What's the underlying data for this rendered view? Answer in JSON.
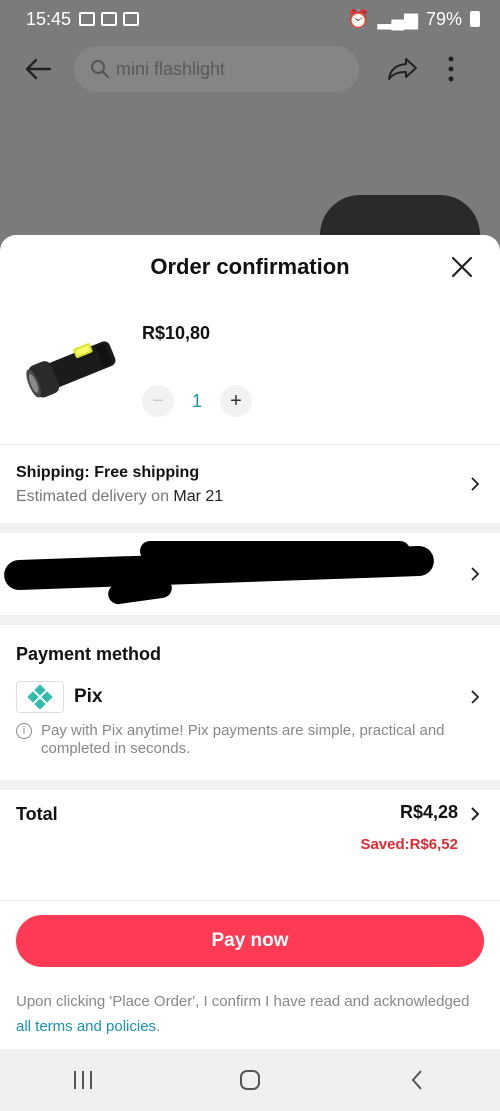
{
  "status_bar": {
    "time": "15:45",
    "battery": "79%"
  },
  "top_nav": {
    "search_placeholder": "mini flashlight"
  },
  "sheet": {
    "title": "Order confirmation",
    "product": {
      "price": "R$10,80",
      "quantity": "1",
      "minus": "−",
      "plus": "+"
    },
    "shipping": {
      "title": "Shipping: Free shipping",
      "delivery_prefix": "Estimated delivery on ",
      "delivery_date": "Mar 21"
    },
    "payment": {
      "title": "Payment method",
      "method": "Pix",
      "note": "Pay with Pix anytime! Pix payments are simple, practical and completed in seconds."
    },
    "total": {
      "label": "Total",
      "value": "R$4,28",
      "saved": "Saved:R$6,52"
    },
    "footer": {
      "pay_button": "Pay now",
      "terms_prefix": "Upon clicking 'Place Order', I confirm I have read and acknowledged ",
      "terms_link": "all terms and policies",
      "terms_suffix": "."
    }
  },
  "colors": {
    "accent": "#fe3a55",
    "link": "#1a93b3",
    "saved": "#e02a35",
    "qty": "#1a9aa8",
    "pix": "#32bcad"
  }
}
